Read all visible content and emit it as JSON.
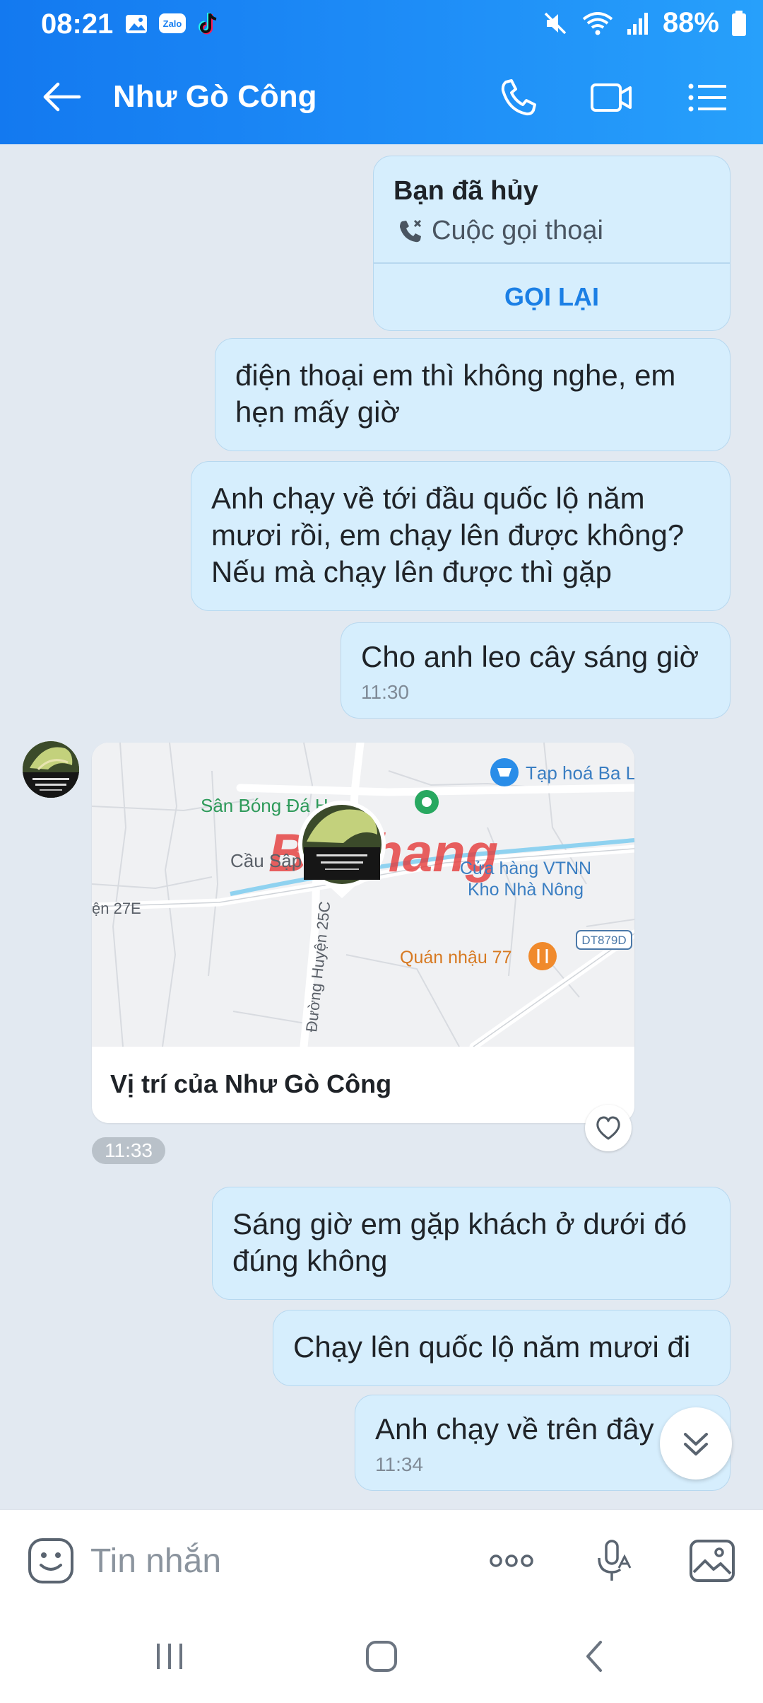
{
  "status_bar": {
    "time": "08:21",
    "battery_percent": "88%",
    "left_icons": [
      "gallery-icon",
      "zalo-icon",
      "tiktok-icon"
    ],
    "zalo_label": "Zalo",
    "right_icons": [
      "mute-icon",
      "wifi-icon",
      "signal-icon",
      "battery-icon"
    ]
  },
  "header": {
    "title": "Như Gò Công",
    "icons": [
      "back-arrow-icon",
      "phone-icon",
      "video-icon",
      "menu-list-icon"
    ]
  },
  "messages": {
    "call": {
      "title": "Bạn đã hủy",
      "subtitle": "Cuộc gọi thoại",
      "action": "GỌI LẠI"
    },
    "m1": "điện thoại em thì không nghe, em hẹn mấy giờ",
    "m2": "Anh chạy về tới đầu quốc lộ năm mươi rồi, em chạy lên được không? Nếu mà chạy lên được thì gặp",
    "m3": "Cho anh leo cây sáng giờ",
    "m3_time": "11:30",
    "location": {
      "caption": "Vị trí của Như Gò Công",
      "time": "11:33",
      "map_labels": {
        "shop": "Tạp hoá Ba L",
        "field": "Sân Bóng Đá H",
        "bridge": "Cầu Sập",
        "store1": "Cửa hàng VTNN",
        "store2": "Kho Nhà Nông",
        "road1": "ện 27E",
        "road2": "Đường Huyện 25C",
        "road3": "DT879D",
        "bar": "Quán nhậu 77",
        "watermark": "Baohang"
      }
    },
    "m4": "Sáng giờ em gặp khách ở dưới đó đúng không",
    "m5": "Chạy lên quốc lộ năm mươi đi",
    "m6": "Anh chạy về trên đây",
    "m6_time": "11:34"
  },
  "input_bar": {
    "placeholder": "Tin nhắn",
    "icons": [
      "emoji-icon",
      "more-icon",
      "voice-icon",
      "image-icon"
    ]
  },
  "colors": {
    "header_start": "#1379f0",
    "header_end": "#27a0fb",
    "bubble": "#d6eefd",
    "chat_bg": "#e2e9f1",
    "action_blue": "#1b7fe5"
  }
}
